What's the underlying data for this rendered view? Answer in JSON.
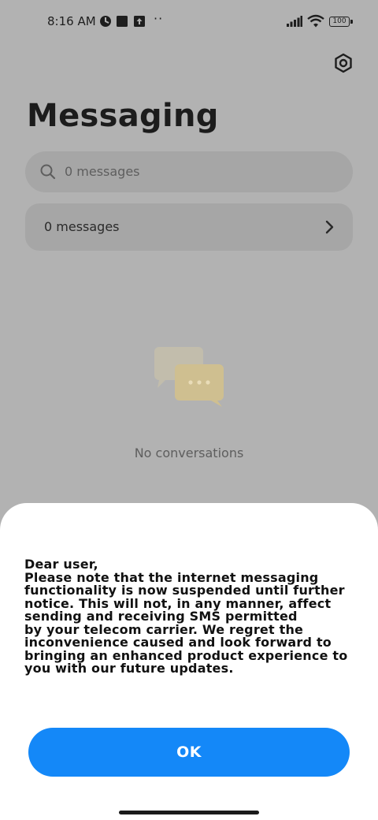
{
  "status_bar": {
    "time": "8:16 AM",
    "more": "··",
    "battery": "100",
    "icons": [
      "status-circle-icon",
      "status-square-icon",
      "upload-icon",
      "signal-icon",
      "wifi-icon",
      "battery-icon"
    ]
  },
  "header": {
    "title": "Messaging",
    "settings_icon": "settings-gear-icon"
  },
  "search": {
    "placeholder": "0 messages",
    "icon": "search-icon"
  },
  "messages_row": {
    "label": "0 messages",
    "icon": "chevron-right-icon"
  },
  "empty_state": {
    "icon": "chat-bubbles-icon",
    "text": "No conversations"
  },
  "dialog": {
    "lines": [
      "Dear user,",
      "Please note that the internet messaging",
      "functionality is now suspended until further",
      "notice. This will not, in any manner, affect",
      "sending and receiving SMS permitted",
      "by your telecom carrier. We regret the",
      "inconvenience caused and look forward to",
      "bringing an enhanced product experience to",
      "you with our future updates."
    ],
    "ok_label": "OK"
  },
  "colors": {
    "overlay_background": "#b2b2b2",
    "sheet_background": "#ffffff",
    "accent": "#1488f8",
    "illustration": "#e8d8a8"
  }
}
